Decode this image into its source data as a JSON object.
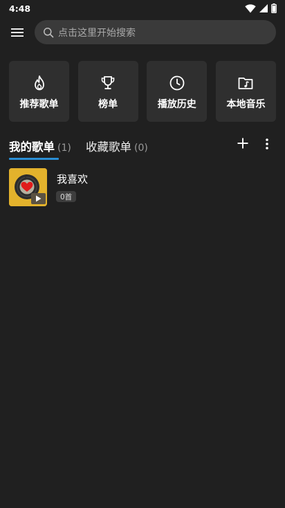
{
  "status_bar": {
    "time": "4:48",
    "icons": [
      "wifi-icon",
      "signal-icon",
      "battery-icon"
    ]
  },
  "header": {
    "menu_icon": "hamburger-menu-icon",
    "search": {
      "icon": "search-icon",
      "placeholder": "点击这里开始搜索"
    }
  },
  "quick_links": [
    {
      "icon": "fire-icon",
      "label": "推荐歌单"
    },
    {
      "icon": "trophy-icon",
      "label": "榜单"
    },
    {
      "icon": "clock-icon",
      "label": "播放历史"
    },
    {
      "icon": "music-folder-icon",
      "label": "本地音乐"
    }
  ],
  "tabs": [
    {
      "label": "我的歌单",
      "count": "(1)",
      "active": true
    },
    {
      "label": "收藏歌单",
      "count": "(0)",
      "active": false
    }
  ],
  "tab_actions": {
    "add_icon": "plus-icon",
    "more_icon": "more-vert-icon"
  },
  "playlists": [
    {
      "title": "我喜欢",
      "count": "0首",
      "cover_icon": "heart-record-cover-icon"
    }
  ],
  "colors": {
    "background": "#202020",
    "card": "#2f2f2f",
    "search": "#3a3a3a",
    "accent": "#2a8fd6",
    "cover": "#e3b22c"
  }
}
